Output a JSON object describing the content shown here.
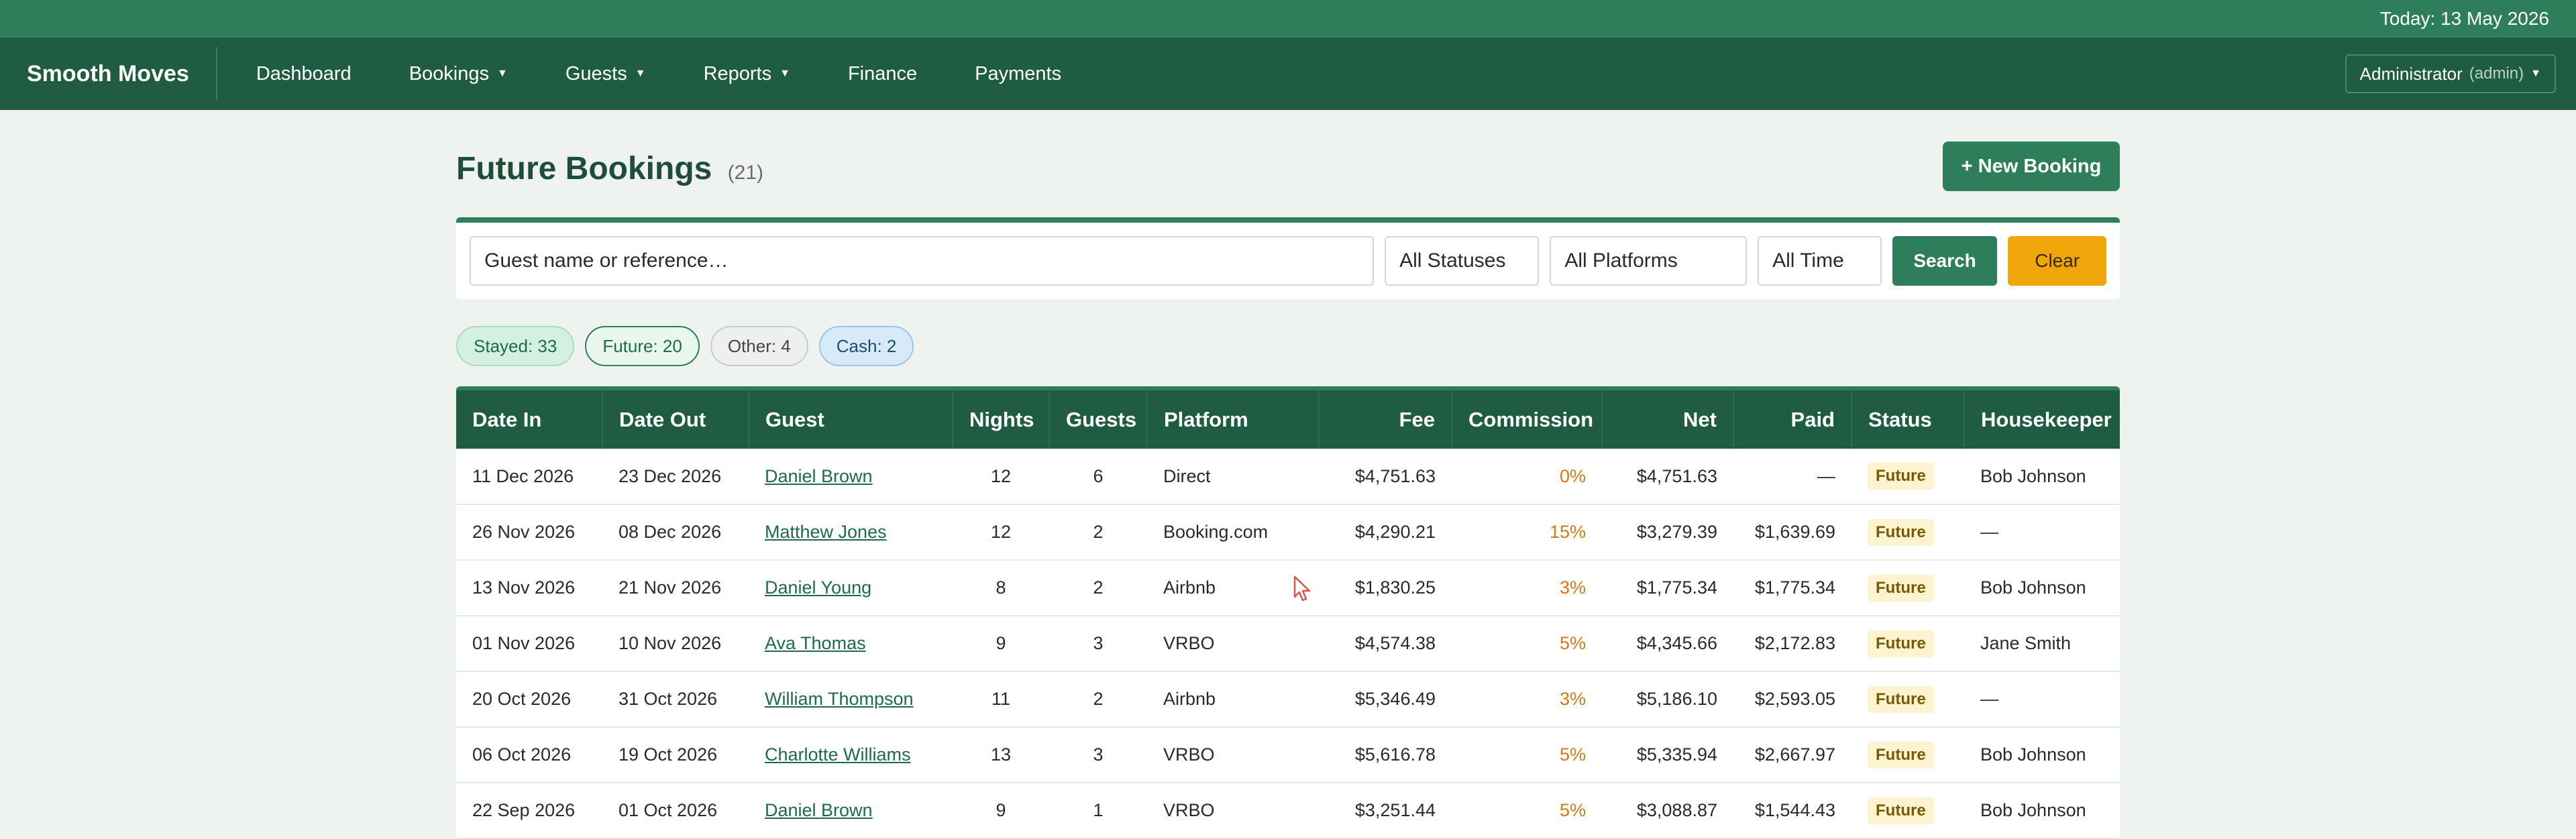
{
  "topbar": {
    "today": "Today: 13 May 2026"
  },
  "nav": {
    "brand": "Smooth Moves",
    "items": [
      {
        "label": "Dashboard",
        "dropdown": false
      },
      {
        "label": "Bookings",
        "dropdown": true
      },
      {
        "label": "Guests",
        "dropdown": true
      },
      {
        "label": "Reports",
        "dropdown": true
      },
      {
        "label": "Finance",
        "dropdown": false
      },
      {
        "label": "Payments",
        "dropdown": false
      }
    ],
    "user": "Administrator",
    "role": "(admin)"
  },
  "page": {
    "title": "Future Bookings",
    "count": "(21)",
    "new_button": "+ New Booking"
  },
  "filters": {
    "search_placeholder": "Guest name or reference…",
    "status": "All Statuses",
    "platform": "All Platforms",
    "time": "All Time",
    "search_button": "Search",
    "clear_button": "Clear"
  },
  "badges": {
    "stayed": "Stayed: 33",
    "future": "Future: 20",
    "other": "Other: 4",
    "cash": "Cash: 2"
  },
  "table": {
    "headers": [
      "Date In",
      "Date Out",
      "Guest",
      "Nights",
      "Guests",
      "Platform",
      "Fee",
      "Commission",
      "Net",
      "Paid",
      "Status",
      "Housekeeper"
    ],
    "rows": [
      [
        "11 Dec 2026",
        "23 Dec 2026",
        "Daniel Brown",
        "12",
        "6",
        "Direct",
        "$4,751.63",
        "0%",
        "$4,751.63",
        "—",
        "Future",
        "Bob Johnson"
      ],
      [
        "26 Nov 2026",
        "08 Dec 2026",
        "Matthew Jones",
        "12",
        "2",
        "Booking.com",
        "$4,290.21",
        "15%",
        "$3,279.39",
        "$1,639.69",
        "Future",
        "—"
      ],
      [
        "13 Nov 2026",
        "21 Nov 2026",
        "Daniel Young",
        "8",
        "2",
        "Airbnb",
        "$1,830.25",
        "3%",
        "$1,775.34",
        "$1,775.34",
        "Future",
        "Bob Johnson"
      ],
      [
        "01 Nov 2026",
        "10 Nov 2026",
        "Ava Thomas",
        "9",
        "3",
        "VRBO",
        "$4,574.38",
        "5%",
        "$4,345.66",
        "$2,172.83",
        "Future",
        "Jane Smith"
      ],
      [
        "20 Oct 2026",
        "31 Oct 2026",
        "William Thompson",
        "11",
        "2",
        "Airbnb",
        "$5,346.49",
        "3%",
        "$5,186.10",
        "$2,593.05",
        "Future",
        "—"
      ],
      [
        "06 Oct 2026",
        "19 Oct 2026",
        "Charlotte Williams",
        "13",
        "3",
        "VRBO",
        "$5,616.78",
        "5%",
        "$5,335.94",
        "$2,667.97",
        "Future",
        "Bob Johnson"
      ],
      [
        "22 Sep 2026",
        "01 Oct 2026",
        "Daniel Brown",
        "9",
        "1",
        "VRBO",
        "$3,251.44",
        "5%",
        "$3,088.87",
        "$1,544.43",
        "Future",
        "Bob Johnson"
      ]
    ]
  },
  "colors": {
    "brand_green": "#1f5c42",
    "accent_green": "#2e7d5b",
    "clear_orange": "#f0a50b",
    "commission": "#d17a1a"
  }
}
